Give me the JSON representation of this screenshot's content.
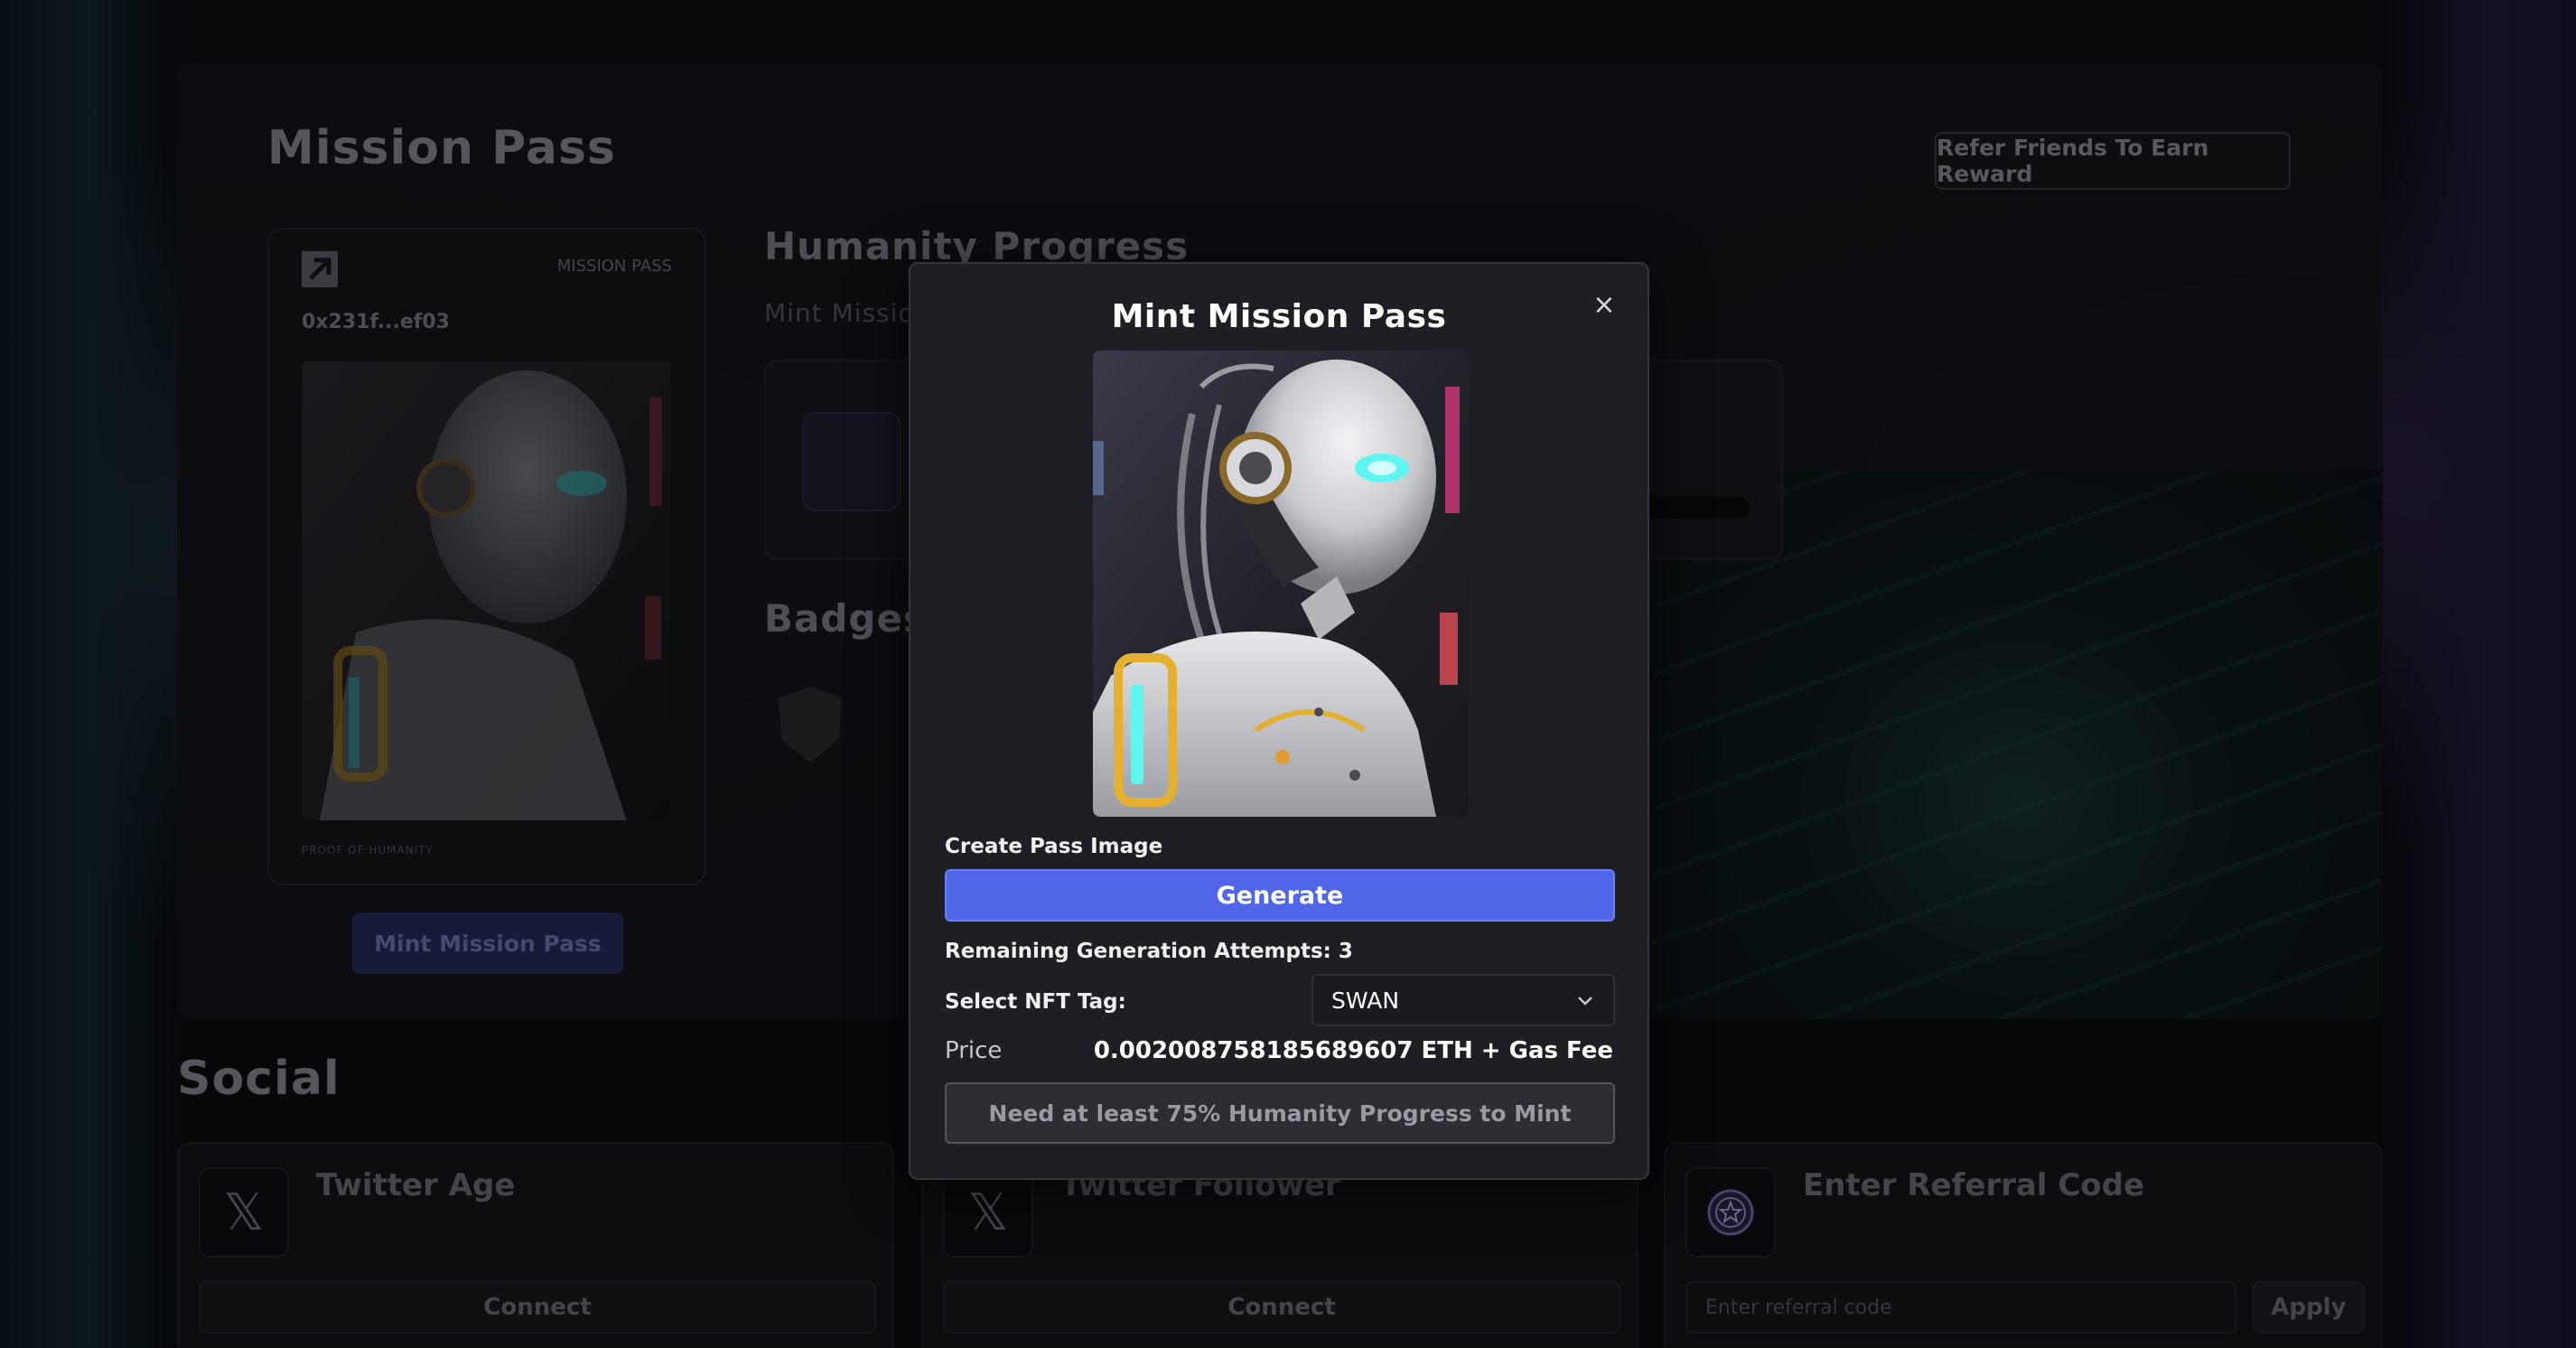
{
  "page": {
    "title": "Mission Pass",
    "refer_button": "Refer Friends To Earn Reward"
  },
  "pass_card": {
    "tag": "MISSION PASS",
    "address": "0x231f...ef03",
    "footer": "PROOF OF HUMANITY",
    "mint_button": "Mint Mission Pass"
  },
  "progress": {
    "heading": "Humanity Progress",
    "subheading": "Mint Mission"
  },
  "badges": {
    "heading": "Badges"
  },
  "social": {
    "heading": "Social",
    "cards": [
      {
        "title": "Twitter Age",
        "action": "Connect"
      },
      {
        "title": "Twitter Follower",
        "action": "Connect"
      },
      {
        "title": "Enter Referral Code",
        "input_placeholder": "Enter referral code",
        "action": "Apply"
      }
    ]
  },
  "modal": {
    "title": "Mint Mission Pass",
    "close_glyph": "×",
    "create_label": "Create Pass Image",
    "generate_button": "Generate",
    "remaining_attempts": "Remaining Generation Attempts: 3",
    "tag_label": "Select NFT Tag:",
    "tag_value": "SWAN",
    "price_label": "Price",
    "price_value": "0.002008758185689607 ETH + Gas Fee",
    "mint_button": "Need at least 75% Humanity Progress to Mint"
  },
  "colors": {
    "accent": "#4f66e6",
    "background": "#07090b",
    "modal_bg": "#1e1f24"
  },
  "icons": {
    "logo": "arrow-up-right-icon",
    "close": "close-icon",
    "twitter": "x-logo-icon",
    "referral": "star-badge-icon",
    "select": "chevron-down-icon"
  }
}
